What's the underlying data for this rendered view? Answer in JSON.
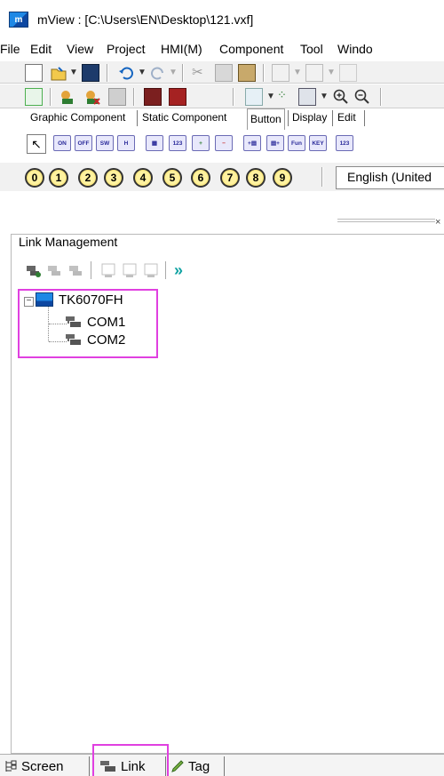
{
  "window": {
    "title": "mView : [C:\\Users\\EN\\Desktop\\121.vxf]",
    "app_icon_letter": "m"
  },
  "menu": [
    "File",
    "Edit",
    "View",
    "Project",
    "HMI(M)",
    "Component",
    "Tool",
    "Windo"
  ],
  "component_tabs": {
    "items": [
      "Graphic Component",
      "Static Component",
      "Button",
      "Display",
      "Edit"
    ],
    "selected": "Button"
  },
  "component_buttons": [
    "ON",
    "OFF",
    "SW",
    "H",
    "▦",
    "123",
    "+",
    "−",
    "+▤",
    "▤+",
    "Fun",
    "KEY",
    "123"
  ],
  "number_buttons": [
    "0",
    "1",
    "2",
    "3",
    "4",
    "5",
    "6",
    "7",
    "8",
    "9"
  ],
  "language": {
    "selected": "English (United"
  },
  "panel": {
    "title": "Link Management",
    "close_glyph": "×",
    "tree": {
      "device": "TK6070FH",
      "expand_glyph": "−",
      "children": [
        "COM1",
        "COM2"
      ]
    }
  },
  "bottom_tabs": [
    "Screen",
    "Link",
    "Tag"
  ],
  "highlight_color": "#e040e0"
}
